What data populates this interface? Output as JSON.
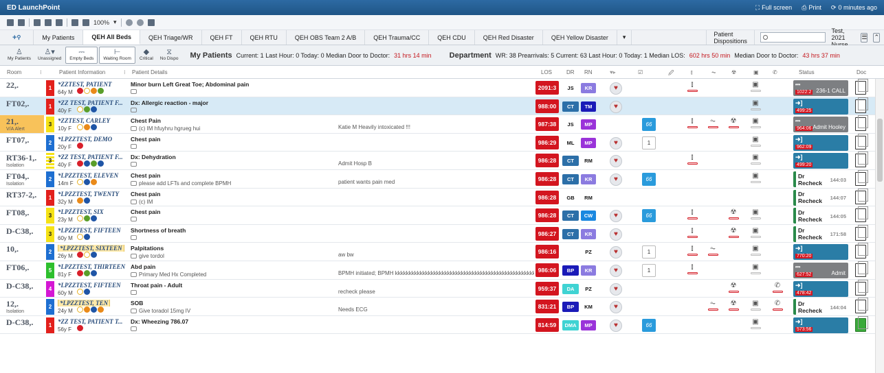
{
  "app": {
    "title": "ED LaunchPoint",
    "fullscreen": "Full screen",
    "print": "Print",
    "refresh": "0 minutes ago"
  },
  "toolbar": {
    "zoom": "100%"
  },
  "tabs": [
    "My Patients",
    "QEH All Beds",
    "QEH Triage/WR",
    "QEH FT",
    "QEH RTU",
    "QEH OBS Team 2 A/B",
    "QEH Trauma/CC",
    "QEH CDU",
    "QEH Red Disaster",
    "QEH Yellow Disaster"
  ],
  "active_tab": "QEH All Beds",
  "dispositions": "Patient Dispositions",
  "user": "Test, 2021 Nurse,",
  "actions": {
    "my_patients": "My Patients",
    "unassigned": "Unassigned",
    "empty_beds": "Empty Beds",
    "waiting_room": "Waiting Room",
    "critical": "Critical",
    "no_dispo": "No Dispo"
  },
  "stats": {
    "mine_label": "My Patients",
    "mine": "Current: 1   Last Hour: 0   Today: 0   Median Door to Doctor:",
    "mine_red": "31 hrs 14 min",
    "dept_label": "Department",
    "dept": "WR: 38   Prearrivals: 5   Current: 63   Last Hour: 0   Today: 1   Median LOS:",
    "dept_red1": "602 hrs 50 min",
    "dept_mid": "Median Door to Doctor:",
    "dept_red2": "43 hrs 37 min"
  },
  "columns": {
    "room": "Room",
    "info": "Patient Information",
    "details": "Patient Details",
    "los": "LOS",
    "dr": "DR",
    "rn": "RN",
    "status": "Status",
    "doc": "Doc"
  },
  "colors": {
    "accent": "#2d6aa3",
    "los": "#d3151f",
    "highlight": "#d7eaf6",
    "alert": "#f8c25a"
  },
  "rows": [
    {
      "room": "22,.",
      "sub": "",
      "acuity": "1",
      "acls": "a1",
      "name": "*ZZTEST, PATIENT",
      "age": "64y M",
      "chief": "Minor burn Left Great Toe; Abdominal pain",
      "comment": "",
      "details": "",
      "los": "2091:3",
      "dr": "JS",
      "rn": "KR",
      "rnc": "#8b7be0",
      "heart": true,
      "order": "",
      "st": "grey",
      "sttime": "1022:2",
      "sttext": "236-1 CALL",
      "doc": "",
      "dots": [
        "d-r",
        "d-y",
        "d-o",
        "d-g"
      ]
    },
    {
      "room": "FT02,.",
      "sub": "",
      "acuity": "1",
      "acls": "a1",
      "name": "*ZZ TEST, PATIENT F...",
      "age": "40y F",
      "chief": "Dx: Allergic reaction - major",
      "comment": "",
      "details": "",
      "los": "988:00",
      "dr": "CT",
      "drc": "#2c6fa8",
      "rn": "TM",
      "rnc": "#1a1ab8",
      "heart": true,
      "order": "",
      "st": "teal",
      "sttime": "499:25",
      "sttext": "",
      "doc": "",
      "hl": true,
      "dots": [
        "d-y",
        "d-g",
        "d-b"
      ]
    },
    {
      "room": "21,.",
      "sub": "V/A Alert",
      "acuity": "3",
      "acls": "a3",
      "name": "*ZZTEST, CARLEY",
      "age": "10y F",
      "chief": "Chest Pain",
      "comment": "(c) IM hfuyhru hgrueg hui",
      "details": "Katie M Heavily intoxicated !!!",
      "los": "987:38",
      "dr": "JS",
      "rn": "MP",
      "rnc": "#9a33d9",
      "heart": false,
      "order": "blue",
      "st": "grey",
      "sttime": "964:06",
      "sttext": "Admit Hooley",
      "doc": "",
      "yel": true,
      "dots": [
        "d-y",
        "d-o",
        "d-b"
      ]
    },
    {
      "room": "FT07,.",
      "sub": "",
      "acuity": "2",
      "acls": "a2",
      "name": "*LPZZTEST, DEMO",
      "age": "20y F",
      "chief": "Chest pain",
      "comment": "",
      "details": "",
      "los": "986:29",
      "dr": "ML",
      "rn": "MP",
      "rnc": "#9a33d9",
      "heart": true,
      "order": "1",
      "st": "teal",
      "sttime": "962:09",
      "sttext": "",
      "doc": "",
      "dots": [
        "d-r"
      ]
    },
    {
      "room": "RT36-1,.",
      "sub": "Isolation",
      "acuity": "3",
      "acls": "a3s",
      "name": "*ZZ TEST, PATIENT F...",
      "age": "40y F",
      "chief": "Dx: Dehydration",
      "comment": "",
      "details": "Admit Hosp B",
      "los": "986:28",
      "dr": "CT",
      "drc": "#2c6fa8",
      "rn": "RM",
      "heart": true,
      "order": "",
      "st": "teal",
      "sttime": "499:20",
      "sttext": "",
      "doc": "",
      "dots": [
        "d-r",
        "d-b",
        "d-g",
        "d-b"
      ]
    },
    {
      "room": "FT04,.",
      "sub": "Isolation",
      "acuity": "2",
      "acls": "a2",
      "name": "*LPZZTEST, ELEVEN",
      "age": "14m F",
      "chief": "Chest pain",
      "comment": "please add LFTs and complete BPMH",
      "details": "patient wants pain med",
      "los": "986:28",
      "dr": "CT",
      "drc": "#2c6fa8",
      "rn": "KR",
      "rnc": "#8b7be0",
      "heart": true,
      "order": "blue",
      "st": "dr",
      "stt": "Dr Recheck",
      "sts": "144:03",
      "doc": "",
      "dots": [
        "d-y",
        "d-b",
        "d-o"
      ]
    },
    {
      "room": "RT37-2,.",
      "sub": "",
      "acuity": "1",
      "acls": "a1",
      "name": "*LPZZTEST, TWENTY",
      "age": "32y M",
      "chief": "Chest pain",
      "comment": "(c) IM",
      "details": "",
      "los": "986:28",
      "dr": "GB",
      "rn": "RM",
      "heart": false,
      "order": "",
      "st": "dr",
      "stt": "Dr Recheck",
      "sts": "144:07",
      "doc": "",
      "dots": [
        "d-o",
        "d-b"
      ]
    },
    {
      "room": "FT08,.",
      "sub": "",
      "acuity": "3",
      "acls": "a3",
      "name": "*LPZZTEST, SIX",
      "age": "23y M",
      "chief": "Chest pain",
      "comment": "",
      "details": "",
      "los": "986:28",
      "dr": "CT",
      "drc": "#2c6fa8",
      "rn": "CW",
      "rnc": "#1a88e0",
      "heart": true,
      "order": "blue",
      "st": "dr",
      "stt": "Dr Recheck",
      "sts": "144:05",
      "doc": "",
      "dots": [
        "d-y",
        "d-g",
        "d-b"
      ]
    },
    {
      "room": "D-C38,.",
      "sub": "",
      "acuity": "3",
      "acls": "a3",
      "name": "*LPZZTEST, FIFTEEN",
      "age": "60y M",
      "chief": "Shortness of breath",
      "comment": "",
      "details": "",
      "los": "986:27",
      "dr": "CT",
      "drc": "#2c6fa8",
      "rn": "KR",
      "rnc": "#8b7be0",
      "heart": true,
      "order": "",
      "st": "dr",
      "stt": "Dr Recheck",
      "sts": "171:58",
      "doc": "",
      "dots": [
        "d-y",
        "d-b"
      ]
    },
    {
      "room": "10,.",
      "sub": "",
      "acuity": "2",
      "acls": "a2",
      "name": "*LPZZTEST, SIXTEEN",
      "badge": true,
      "age": "26y M",
      "chief": "Palpitations",
      "comment": "give tordol",
      "details": "aw bw",
      "los": "986:16",
      "dr": "",
      "rn": "PZ",
      "heart": true,
      "order": "1",
      "st": "teal",
      "sttime": "770:20",
      "sttext": "",
      "doc": "",
      "dots": [
        "d-r",
        "d-y",
        "d-b"
      ]
    },
    {
      "room": "FT06,.",
      "sub": "",
      "acuity": "5",
      "acls": "a5",
      "name": "*LPZZTEST, THIRTEEN",
      "age": "81y F",
      "chief": "Abd pain",
      "comment": "Primary Med Hx Completed",
      "details": "BPMH initiated; BPMH kkkkkkkkkkkkkkkkkkkkkkkkkkkkkkkkkkkkkkkkkkkkkkkkkkkkkkkkk...",
      "los": "986:06",
      "dr": "BP",
      "drc": "#1a1ab8",
      "drt": "#fff",
      "rn": "KR",
      "rnc": "#8b7be0",
      "heart": true,
      "order": "1",
      "st": "grey",
      "sttime": "627:52",
      "sttext": "Admit",
      "doc": "",
      "dots": [
        "d-r",
        "d-g",
        "d-b"
      ]
    },
    {
      "room": "D-C38,.",
      "sub": "",
      "acuity": "4",
      "acls": "a4",
      "name": "*LPZZTEST, FIFTEEN",
      "age": "60y M",
      "chief": "Throat pain - Adult",
      "comment": "",
      "details": "recheck please",
      "los": "959:37",
      "dr": "DA",
      "drc": "#3fd3d3",
      "rn": "PZ",
      "heart": true,
      "order": "",
      "st": "teal",
      "sttime": "478:42",
      "sttext": "",
      "doc": "",
      "dots": [
        "d-y",
        "d-b"
      ]
    },
    {
      "room": "12,.",
      "sub": "Isolation",
      "acuity": "2",
      "acls": "a2",
      "name": "*LPZZTEST, TEN",
      "badge": true,
      "age": "24y M",
      "chief": "SOB",
      "comment": "Give toradol 15mg IV",
      "details": "Needs ECG",
      "los": "831:21",
      "dr": "BP",
      "drc": "#1a1ab8",
      "drt": "#fff",
      "rn": "KM",
      "heart": true,
      "order": "",
      "st": "dr",
      "stt": "Dr Recheck",
      "sts": "144:04",
      "doc": "",
      "dots": [
        "d-y",
        "d-o",
        "d-b",
        "d-o"
      ]
    },
    {
      "room": "D-C38,.",
      "sub": "",
      "acuity": "1",
      "acls": "a1",
      "name": "*ZZ TEST, PATIENT T...",
      "age": "56y F",
      "chief": "Dx: Wheezing 786.07",
      "comment": "",
      "details": "",
      "los": "814:59",
      "dr": "DMA",
      "drc": "#3fd3d3",
      "rn": "MP",
      "rnc": "#9a33d9",
      "heart": true,
      "order": "blue",
      "st": "teal",
      "sttime": "573:56",
      "sttext": "",
      "doc": "green",
      "dots": [
        "d-r"
      ]
    }
  ],
  "icons": {
    "order_label": "66"
  }
}
